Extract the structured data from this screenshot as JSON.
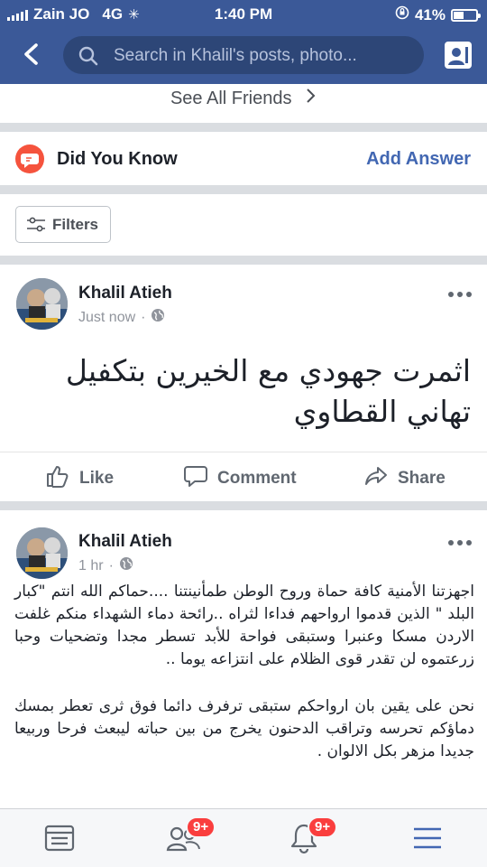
{
  "status_bar": {
    "carrier": "Zain JO",
    "network": "4G",
    "time": "1:40 PM",
    "battery": "41%"
  },
  "header": {
    "search_placeholder": "Search in Khalil's posts, photo..."
  },
  "friends": {
    "see_all": "See All Friends"
  },
  "did_you_know": {
    "title": "Did You Know",
    "action": "Add Answer"
  },
  "filters": {
    "label": "Filters"
  },
  "posts": [
    {
      "author": "Khalil Atieh",
      "time": "Just now",
      "text": "اثمرت جهودي مع الخيرين بتكفيل تهاني القطاوي",
      "actions": {
        "like": "Like",
        "comment": "Comment",
        "share": "Share"
      }
    },
    {
      "author": "Khalil Atieh",
      "time": "1 hr",
      "paragraphs": [
        "اجهزتنا الأمنية كافة حماة وروح الوطن طمأنينتنا ....حماكم الله انتم \"كبار البلد \" الذين قدموا ارواحهم فداءا لثراه ..رائحة دماء الشهداء منكم غلفت الاردن مسكا وعنبرا وستبقى فواحة للأبد تسطر مجدا وتضحيات وحبا زرعتموه لن تقدر قوى الظلام على انتزاعه يوما ..",
        "نحن على يقين بان ارواحكم ستبقى ترفرف دائما فوق ثرى تعطر بمسك دماؤكم تحرسه وتراقب الدحنون يخرج من بين حباته ليبعث فرحا وربيعا جديدا مزهر بكل الالوان ."
      ]
    }
  ],
  "tabbar": {
    "friends_badge": "9+",
    "notifications_badge": "9+"
  }
}
